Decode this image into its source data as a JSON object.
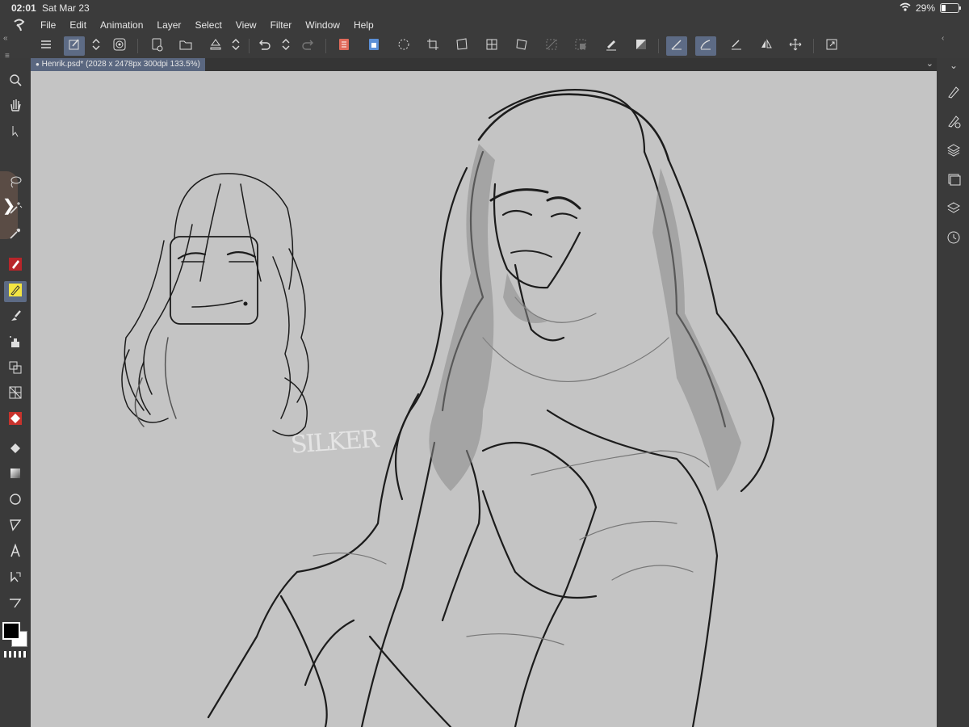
{
  "status_bar": {
    "time": "02:01",
    "date": "Sat Mar 23",
    "battery": "29%",
    "battery_level": 0.29
  },
  "menu": {
    "items": [
      "File",
      "Edit",
      "Animation",
      "Layer",
      "Select",
      "View",
      "Filter",
      "Window",
      "Help"
    ]
  },
  "document_tab": {
    "label": "Henrik.psd* (2028 x 2478px 300dpi 133.5%)"
  },
  "canvas": {
    "watermark": "SILKER"
  },
  "colors": {
    "foreground": "#000000",
    "background": "#ffffff",
    "active_tool_bg": "#5d6b85",
    "canvas_bg": "#c4c4c4"
  },
  "icons": {
    "toolbar": [
      "menu-icon",
      "new-canvas-icon",
      "chevron-updown-icon",
      "spiral-icon",
      "new-file-icon",
      "open-folder-icon",
      "save-icon",
      "chevron-updown-icon",
      "undo-icon",
      "chevron-updown-icon",
      "redo-icon",
      "clear-layer-icon",
      "paste-icon",
      "loading-icon",
      "crop-icon",
      "transform-icon",
      "mesh-transform-icon",
      "free-transform-icon",
      "hide-selection-icon",
      "fill-icon",
      "pen-ruler-icon",
      "invert-icon",
      "snap-ruler-icon",
      "snap-special-icon",
      "snap-grid-icon",
      "flip-horizontal-icon",
      "move-icon",
      "fullscreen-icon"
    ],
    "left": [
      "zoom-icon",
      "hand-icon",
      "move-layer-icon",
      "lasso-icon",
      "magic-wand-icon",
      "eyedropper-icon",
      "pen-icon",
      "pencil-icon",
      "brush-icon",
      "airbrush-icon",
      "decoration-icon",
      "eraser-icon",
      "blend-icon",
      "fill-bucket-icon",
      "gradient-icon",
      "ellipse-icon",
      "figure-icon",
      "text-icon",
      "operation-icon",
      "ruler-icon"
    ],
    "right": [
      "brush-settings-icon",
      "sub-tool-icon",
      "layers-icon",
      "navigator-icon",
      "material-icon",
      "history-icon"
    ]
  }
}
